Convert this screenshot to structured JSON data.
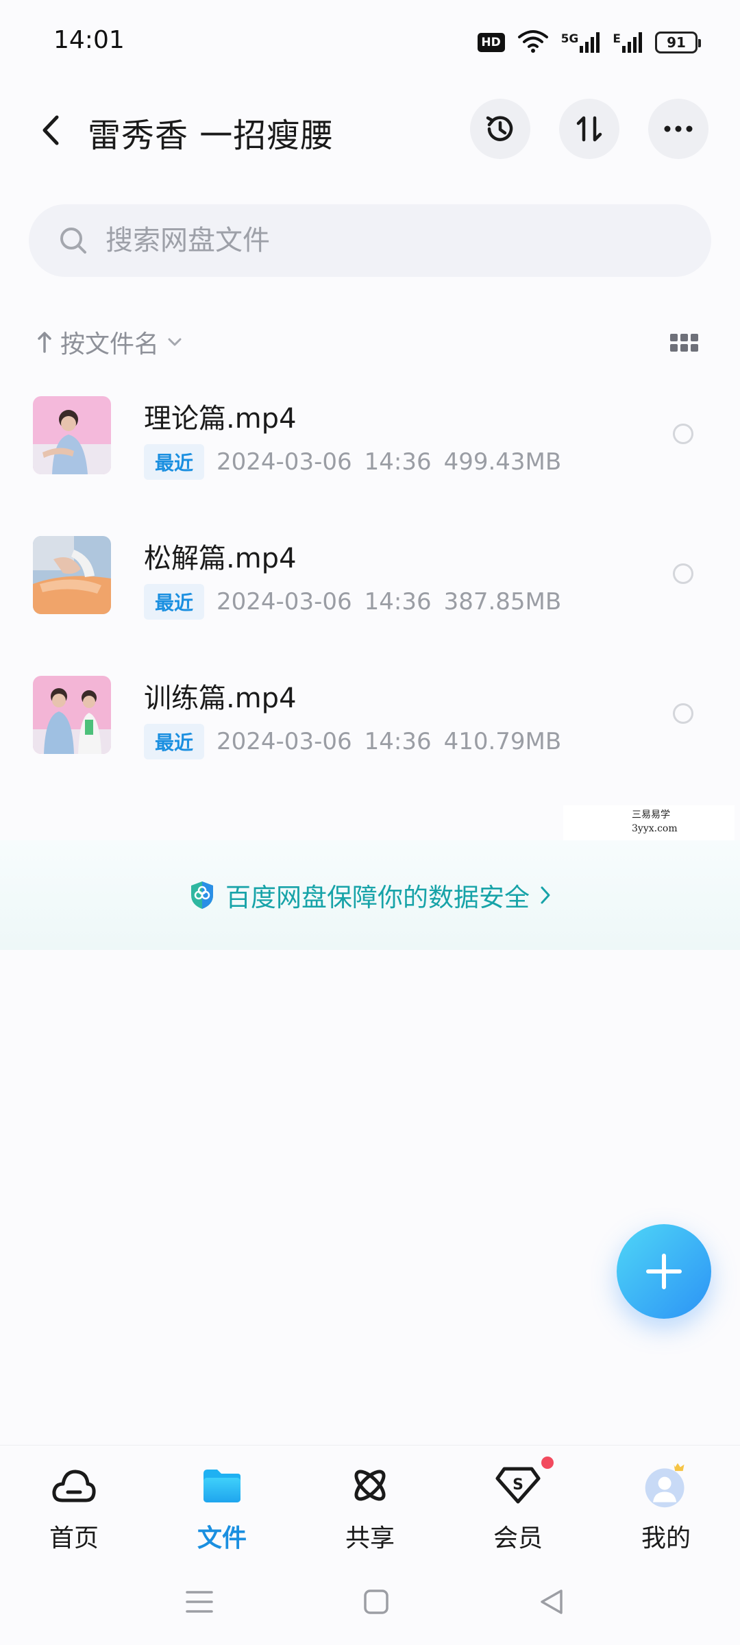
{
  "status_bar": {
    "time": "14:01",
    "hd": "HD",
    "network_1": "5G",
    "network_2": "E",
    "battery": "91"
  },
  "header": {
    "title": "雷秀香 一招瘦腰",
    "back_icon": "chevron-left-icon",
    "history_icon": "history-clock-icon",
    "sort_icon": "transfer-arrows-icon",
    "more_icon": "ellipsis-icon"
  },
  "search": {
    "placeholder": "搜索网盘文件",
    "value": ""
  },
  "sort_bar": {
    "label": "按文件名",
    "direction_icon": "arrow-up-icon",
    "dropdown_icon": "chevron-down-icon",
    "view_icon": "grid-view-icon"
  },
  "files": [
    {
      "name": "理论篇.mp4",
      "badge": "最近",
      "date": "2024-03-06",
      "time": "14:36",
      "size": "499.43MB"
    },
    {
      "name": "松解篇.mp4",
      "badge": "最近",
      "date": "2024-03-06",
      "time": "14:36",
      "size": "387.85MB"
    },
    {
      "name": "训练篇.mp4",
      "badge": "最近",
      "date": "2024-03-06",
      "time": "14:36",
      "size": "410.79MB"
    }
  ],
  "watermark": {
    "line1": "三易易学",
    "line2": "3yyx.com"
  },
  "safety_banner": {
    "text": "百度网盘保障你的数据安全",
    "icon": "shield-icon"
  },
  "fab": {
    "icon": "plus-icon"
  },
  "bottom_nav": [
    {
      "label": "首页",
      "icon": "cloud-icon",
      "active": false
    },
    {
      "label": "文件",
      "icon": "folder-icon",
      "active": true
    },
    {
      "label": "共享",
      "icon": "atom-icon",
      "active": false
    },
    {
      "label": "会员",
      "icon": "vip-diamond-icon",
      "active": false
    },
    {
      "label": "我的",
      "icon": "avatar-icon",
      "active": false
    }
  ],
  "colors": {
    "accent": "#1A8FE0",
    "teal": "#17A3A8",
    "badge_bg": "#EAF2FB",
    "fab_from": "#4FD6F7",
    "fab_to": "#2C93F5",
    "notification": "#F24A5E"
  }
}
